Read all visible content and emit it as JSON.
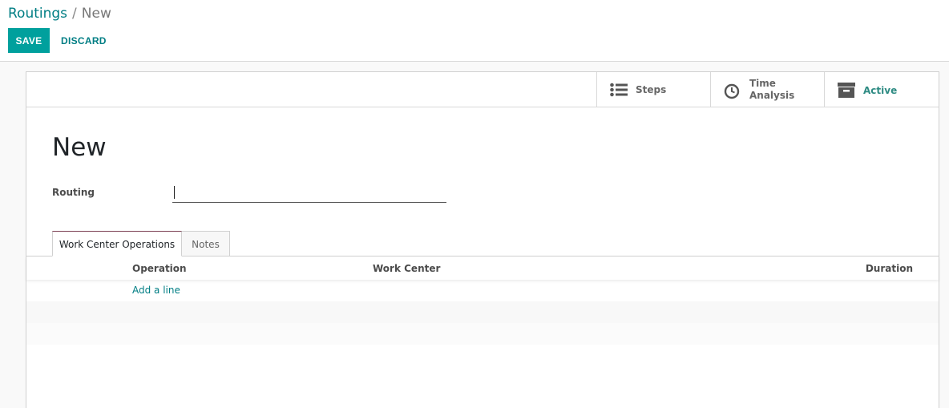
{
  "breadcrumb": {
    "parent": "Routings",
    "separator": "/",
    "current": "New"
  },
  "actions": {
    "save_label": "SAVE",
    "discard_label": "DISCARD"
  },
  "stat_buttons": {
    "steps": {
      "label": "Steps",
      "icon": "list-icon"
    },
    "time_analysis": {
      "label_line1": "Time",
      "label_line2": "Analysis",
      "icon": "clock-icon"
    },
    "active": {
      "label": "Active",
      "icon": "archive-icon"
    }
  },
  "form": {
    "title": "New",
    "routing_label": "Routing",
    "routing_value": ""
  },
  "tabs": [
    {
      "label": "Work Center Operations",
      "active": true
    },
    {
      "label": "Notes",
      "active": false
    }
  ],
  "operations_table": {
    "columns": [
      "Operation",
      "Work Center",
      "Duration"
    ],
    "add_line_label": "Add a line"
  },
  "colors": {
    "primary": "#00a09d",
    "link": "#017e84",
    "active_tab_border": "#7c3f53"
  }
}
